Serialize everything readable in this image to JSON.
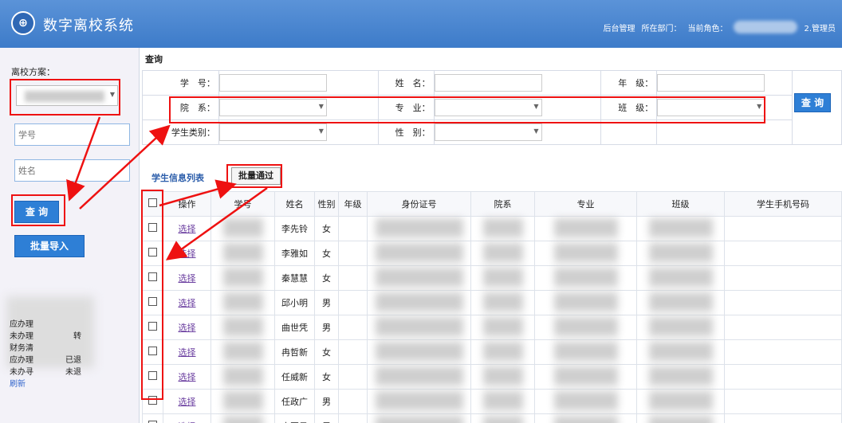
{
  "header": {
    "title": "数字离校系统",
    "logo_text": "⊕",
    "admin_link": "后台管理",
    "dept_label": "所在部门：",
    "role_label": "当前角色：",
    "user_suffix": "2.管理员"
  },
  "sidebar": {
    "plan_label": "离校方案：",
    "student_no_placeholder": "学号",
    "name_placeholder": "姓名",
    "query_button": "查 询",
    "import_button": "批量导入",
    "stats": [
      {
        "left": "应办理",
        "right": ""
      },
      {
        "left": "未办理",
        "right": "转"
      },
      {
        "left": "财务清",
        "right": ""
      },
      {
        "left": "应办理",
        "right": "已退"
      },
      {
        "left": "未办寻",
        "right": "未退"
      }
    ],
    "refresh": "刷新"
  },
  "query": {
    "title": "查询",
    "student_no_label": "学　号：",
    "name_label": "姓　名：",
    "grade_label": "年　级：",
    "dept_label": "院　系：",
    "major_label": "专　业：",
    "class_label": "班　级：",
    "student_type_label": "学生类别：",
    "gender_label": "性　别：",
    "query_button": "查 询"
  },
  "list": {
    "title": "学生信息列表",
    "batch_pass_button": "批量通过",
    "columns": [
      "",
      "操作",
      "学号",
      "姓名",
      "性别",
      "年级",
      "身份证号",
      "院系",
      "专业",
      "班级",
      "学生手机号码"
    ],
    "action_label": "选择",
    "rows": [
      {
        "name": "李先铃",
        "gender": "女"
      },
      {
        "name": "李雅如",
        "gender": "女"
      },
      {
        "name": "秦慧慧",
        "gender": "女"
      },
      {
        "name": "邱小明",
        "gender": "男"
      },
      {
        "name": "曲世凭",
        "gender": "男"
      },
      {
        "name": "冉哲新",
        "gender": "女"
      },
      {
        "name": "任威新",
        "gender": "女"
      },
      {
        "name": "任政广",
        "gender": "男"
      },
      {
        "name": "商冠星",
        "gender": "男"
      }
    ]
  },
  "colors": {
    "header_bg": "#3d7bc9",
    "button_blue": "#2e7fd6",
    "annotation_red": "#e11111"
  }
}
